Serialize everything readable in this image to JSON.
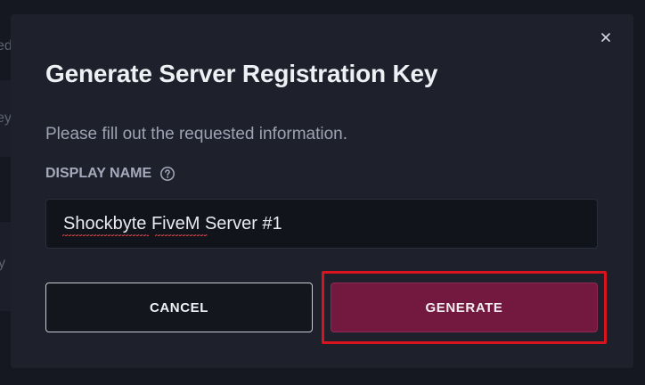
{
  "backdrop": {
    "fragments": [
      "ed",
      "ey",
      "y"
    ]
  },
  "modal": {
    "title": "Generate Server Registration Key",
    "description": "Please fill out the requested information.",
    "close_icon": "close-icon",
    "field": {
      "label": "DISPLAY NAME",
      "help_icon": "question-circle-icon",
      "value": "Shockbyte FiveM Server #1",
      "misspelled_words": [
        "Shockbyte",
        "FiveM"
      ]
    },
    "buttons": {
      "cancel_label": "CANCEL",
      "generate_label": "GENERATE"
    }
  },
  "colors": {
    "modal_background": "#1e212b",
    "primary_button": "#731940",
    "highlight_border": "#d9141f",
    "spellcheck_underline": "#e03b3b"
  }
}
